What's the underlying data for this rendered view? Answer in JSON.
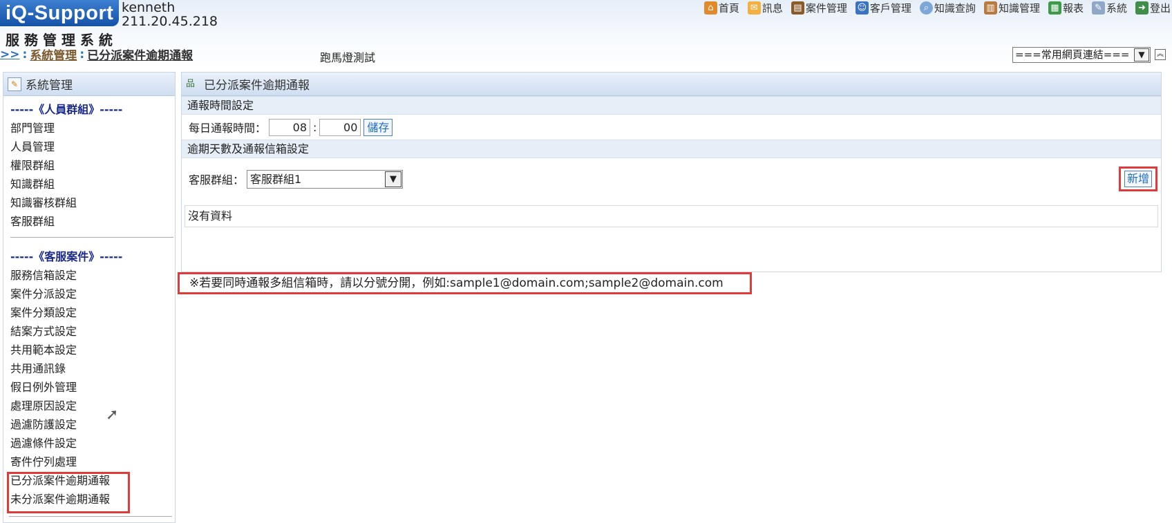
{
  "header": {
    "logo": "iQ-Support",
    "system_name": "服務管理系統",
    "user": "kenneth",
    "ip": "211.20.45.218"
  },
  "topnav": [
    {
      "label": "首頁",
      "icon": "home-icon",
      "glyph": "⌂"
    },
    {
      "label": "訊息",
      "icon": "mail-icon",
      "glyph": "✉"
    },
    {
      "label": "案件管理",
      "icon": "case-icon",
      "glyph": "▤"
    },
    {
      "label": "客戶管理",
      "icon": "customer-icon",
      "glyph": "☺"
    },
    {
      "label": "知識查詢",
      "icon": "search-icon",
      "glyph": "⌕"
    },
    {
      "label": "知識管理",
      "icon": "knowledge-icon",
      "glyph": "▥"
    },
    {
      "label": "報表",
      "icon": "report-icon",
      "glyph": "▦"
    },
    {
      "label": "系統",
      "icon": "system-icon",
      "glyph": "✎"
    },
    {
      "label": "登出",
      "icon": "logout-icon",
      "glyph": "➜"
    }
  ],
  "breadcrumb": {
    "arrows": ">>",
    "sep": ":",
    "parent": "系統管理",
    "current": "已分派案件逾期通報"
  },
  "marquee": "跑馬燈測試",
  "quicklinks": {
    "selected": "===常用網頁連結==="
  },
  "sidebar": {
    "title": "系統管理",
    "group1_title": "-----《人員群組》-----",
    "group1_items": [
      "部門管理",
      "人員管理",
      "權限群組",
      "知識群組",
      "知識審核群組",
      "客服群組"
    ],
    "group2_title": "-----《客服案件》-----",
    "group2_items": [
      "服務信箱設定",
      "案件分派設定",
      "案件分類設定",
      "結案方式設定",
      "共用範本設定",
      "共用通訊錄",
      "假日例外管理",
      "處理原因設定",
      "過濾防護設定",
      "過濾條件設定",
      "寄件佇列處理",
      "已分派案件逾期通報",
      "未分派案件逾期通報"
    ]
  },
  "main": {
    "title": "已分派案件逾期通報",
    "section1": "通報時間設定",
    "time_label": "每日通報時間：",
    "hour": "08",
    "colon": ":",
    "minute": "00",
    "save_label": "儲存",
    "section2": "逾期天數及通報信箱設定",
    "group_label": "客服群組：",
    "group_selected": "客服群組1",
    "add_label": "新增",
    "no_data": "沒有資料"
  },
  "note": "※若要同時通報多組信箱時，請以分號分開，例如:sample1@domain.com;sample2@domain.com"
}
